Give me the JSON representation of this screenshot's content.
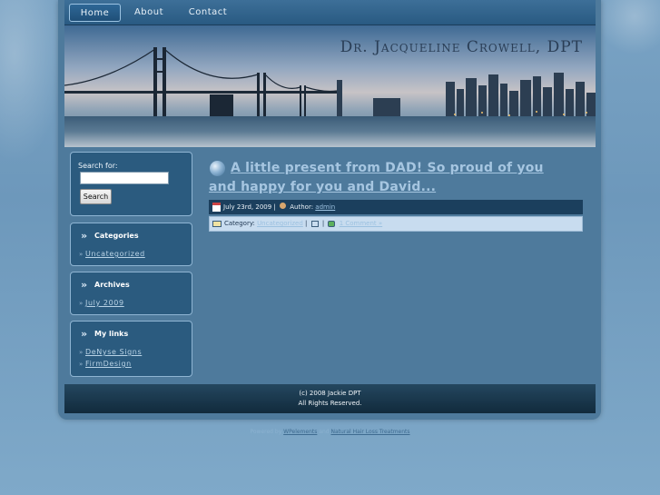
{
  "nav": {
    "items": [
      {
        "label": "Home",
        "active": true
      },
      {
        "label": "About",
        "active": false
      },
      {
        "label": "Contact",
        "active": false
      }
    ]
  },
  "header": {
    "site_title": "Dr. Jacqueline Crowell, DPT"
  },
  "sidebar": {
    "search": {
      "label": "Search for:",
      "value": "",
      "button_label": "Search"
    },
    "categories": {
      "title": "Categories",
      "links": [
        "Uncategorized"
      ]
    },
    "archives": {
      "title": "Archives",
      "links": [
        "July 2009"
      ]
    },
    "mylinks": {
      "title": "My links",
      "links": [
        "DeNyse Signs",
        "FirmDesign"
      ]
    }
  },
  "post": {
    "title": "A little present from DAD! So proud of you and happy for you and David...",
    "date": "July 23rd, 2009",
    "author_label": "Author:",
    "author": "admin",
    "category_label": "Category:",
    "category": "Uncategorized",
    "comments": "1 Comment »"
  },
  "footer": {
    "line1": "(c) 2008 Jackie DPT",
    "line2": "All Rights Reserved."
  },
  "credits": {
    "prefix": "Powered by",
    "link1": "WPelements",
    "middle": "and",
    "link2": "Natural Hair Loss Treatments"
  },
  "colors": {
    "page_bg": "#7aa3c4",
    "panel": "#4e7a9c",
    "box": "#2b5b7f",
    "link": "#a6c6e1"
  }
}
